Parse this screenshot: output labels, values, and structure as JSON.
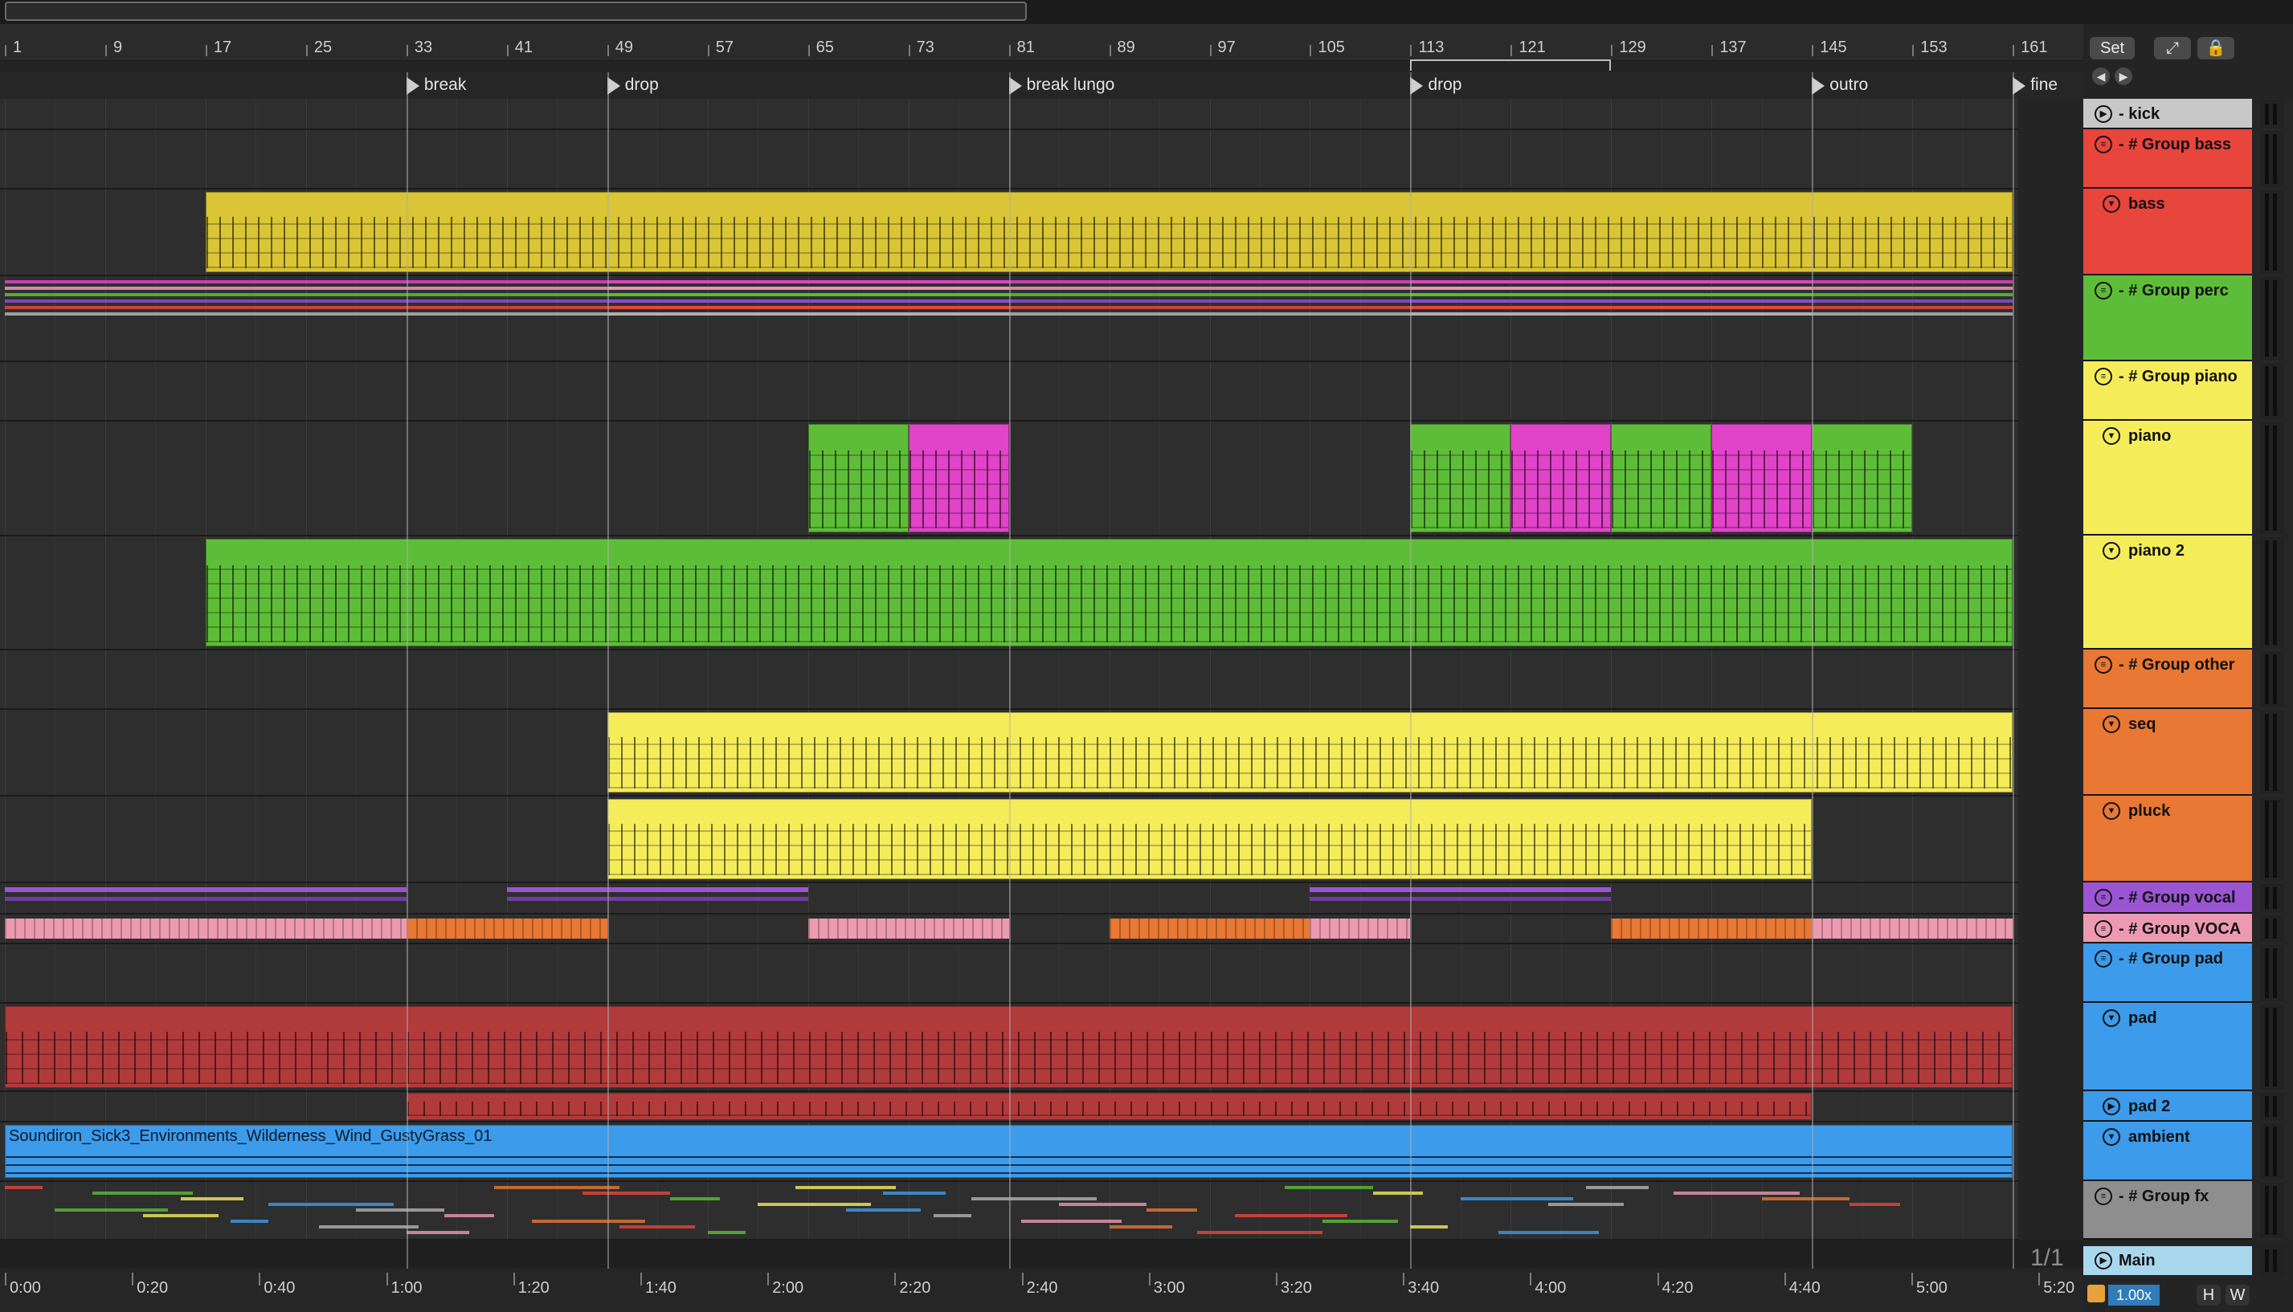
{
  "bar_numbers": [
    "1",
    "9",
    "17",
    "25",
    "33",
    "41",
    "49",
    "57",
    "65",
    "73",
    "81",
    "89",
    "97",
    "105",
    "113",
    "121",
    "129",
    "137",
    "145",
    "153",
    "161"
  ],
  "time_labels": [
    "0:00",
    "0:20",
    "0:40",
    "1:00",
    "1:20",
    "1:40",
    "2:00",
    "2:20",
    "2:40",
    "3:00",
    "3:20",
    "3:40",
    "4:00",
    "4:20",
    "4:40",
    "5:00",
    "5:20"
  ],
  "locators": [
    {
      "label": "break",
      "bar": 33
    },
    {
      "label": "drop",
      "bar": 49
    },
    {
      "label": "break lungo",
      "bar": 81
    },
    {
      "label": "drop",
      "bar": 113
    },
    {
      "label": "outro",
      "bar": 145
    },
    {
      "label": "fine",
      "bar": 161
    }
  ],
  "loop_brace": {
    "start": 113,
    "end": 129
  },
  "controls": {
    "set_label": "Set",
    "page_indicator": "1/1",
    "zoom_value": "1.00x",
    "h_label": "H",
    "w_label": "W"
  },
  "tracks": [
    {
      "name": "- kick",
      "color": "#c8c8c8",
      "icon": "play-icon",
      "type": "audio"
    },
    {
      "name": "- # Group bass",
      "color": "#e8453c",
      "icon": "group-icon",
      "type": "group"
    },
    {
      "name": "bass",
      "color": "#e8453c",
      "icon": "fold-icon",
      "type": "midi"
    },
    {
      "name": "- # Group perc",
      "color": "#5ebd38",
      "icon": "group-icon",
      "type": "group"
    },
    {
      "name": "- # Group piano",
      "color": "#f5ec5a",
      "icon": "group-icon",
      "type": "group"
    },
    {
      "name": "piano",
      "color": "#f5ec5a",
      "icon": "fold-icon",
      "type": "midi"
    },
    {
      "name": "piano 2",
      "color": "#f5ec5a",
      "icon": "fold-icon",
      "type": "midi"
    },
    {
      "name": "- # Group other",
      "color": "#e87833",
      "icon": "group-icon",
      "type": "group"
    },
    {
      "name": "seq",
      "color": "#e87833",
      "icon": "fold-icon",
      "type": "midi"
    },
    {
      "name": "pluck",
      "color": "#e87833",
      "icon": "fold-icon",
      "type": "midi"
    },
    {
      "name": "- # Group vocal",
      "color": "#9b55d3",
      "icon": "group-icon",
      "type": "group"
    },
    {
      "name": "- # Group VOCA",
      "color": "#ec9ab1",
      "icon": "group-icon",
      "type": "group"
    },
    {
      "name": "- # Group pad",
      "color": "#3c9bea",
      "icon": "group-icon",
      "type": "group"
    },
    {
      "name": "pad",
      "color": "#3c9bea",
      "icon": "fold-icon",
      "type": "midi"
    },
    {
      "name": "pad 2",
      "color": "#3c9bea",
      "icon": "play-icon",
      "type": "midi"
    },
    {
      "name": "ambient",
      "color": "#3c9bea",
      "icon": "fold-icon",
      "type": "audio"
    },
    {
      "name": "- # Group fx",
      "color": "#8e8e8e",
      "icon": "group-icon",
      "type": "group"
    },
    {
      "name": "Main",
      "color": "#a9d7ee",
      "icon": "play-icon",
      "type": "main"
    }
  ],
  "clips": {
    "ambient_name": "Soundiron_Sick3_Environments_Wilderness_Wind_GustyGrass_01"
  },
  "colors": {
    "bass": "#d9c535",
    "piano_green": "#5ebd38",
    "piano_pink": "#e143c9",
    "piano2": "#5ebd38",
    "seq": "#f5ec5a",
    "pluck": "#f5ec5a",
    "pad": "#b13a3a",
    "ambient": "#3c9bea",
    "voca_pink": "#ec9ab1",
    "voca_orange": "#e87833"
  }
}
